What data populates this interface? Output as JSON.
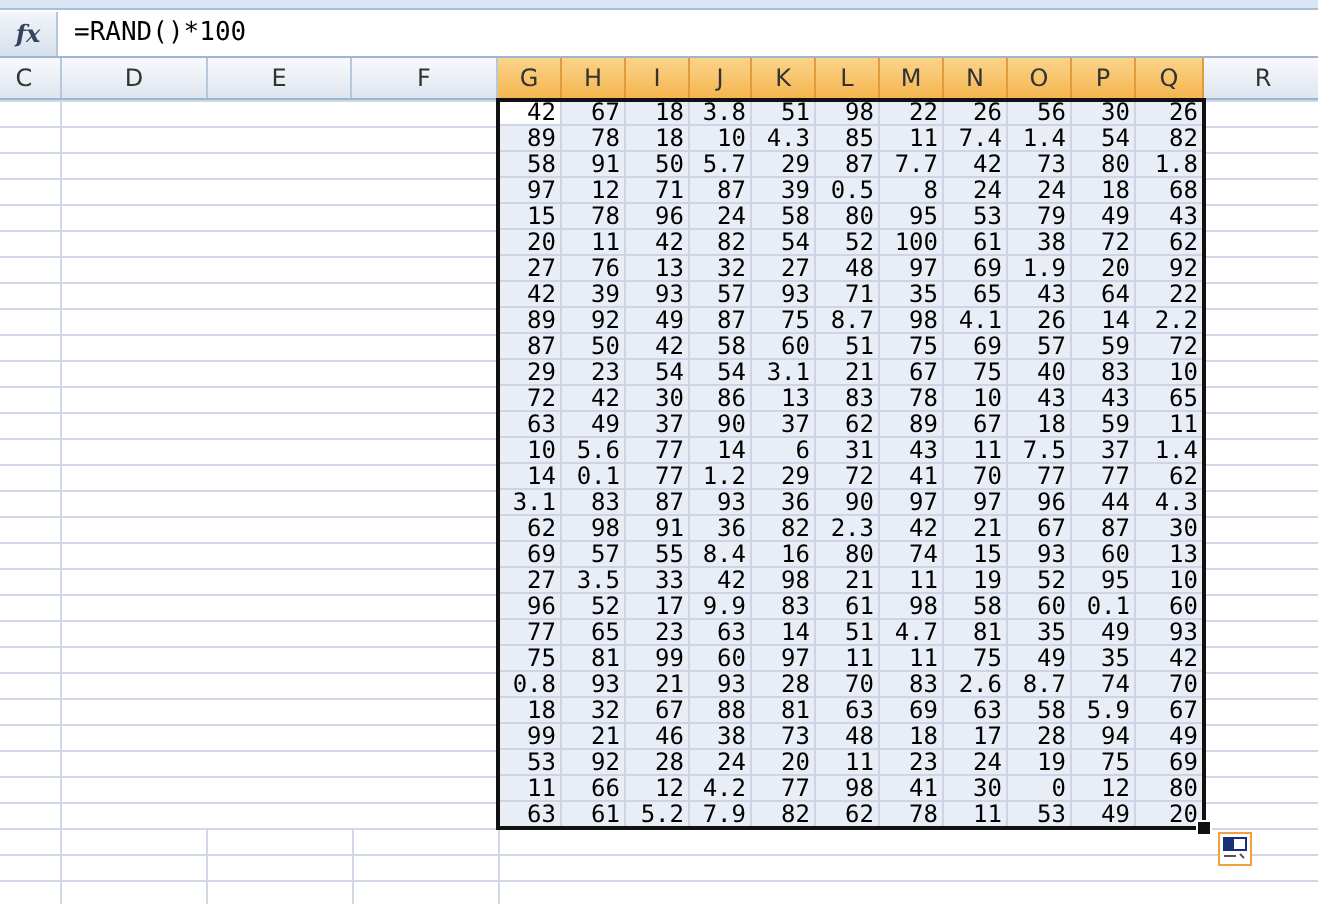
{
  "formula_bar": {
    "fx_label": "fx",
    "formula": "=RAND()*100"
  },
  "columns": [
    {
      "letter": "C",
      "selected": false
    },
    {
      "letter": "D",
      "selected": false
    },
    {
      "letter": "E",
      "selected": false
    },
    {
      "letter": "F",
      "selected": false
    },
    {
      "letter": "G",
      "selected": true
    },
    {
      "letter": "H",
      "selected": true
    },
    {
      "letter": "I",
      "selected": true
    },
    {
      "letter": "J",
      "selected": true
    },
    {
      "letter": "K",
      "selected": true
    },
    {
      "letter": "L",
      "selected": true
    },
    {
      "letter": "M",
      "selected": true
    },
    {
      "letter": "N",
      "selected": true
    },
    {
      "letter": "O",
      "selected": true
    },
    {
      "letter": "P",
      "selected": true
    },
    {
      "letter": "Q",
      "selected": true
    },
    {
      "letter": "R",
      "selected": false
    }
  ],
  "rows": [
    {
      "active_cell": true,
      "values": [
        "42",
        "67",
        "18",
        "3.8",
        "51",
        "98",
        "22",
        "26",
        "56",
        "30",
        "26"
      ]
    },
    {
      "active_cell": false,
      "values": [
        "89",
        "78",
        "18",
        "10",
        "4.3",
        "85",
        "11",
        "7.4",
        "1.4",
        "54",
        "82"
      ]
    },
    {
      "active_cell": false,
      "values": [
        "58",
        "91",
        "50",
        "5.7",
        "29",
        "87",
        "7.7",
        "42",
        "73",
        "80",
        "1.8"
      ]
    },
    {
      "active_cell": false,
      "values": [
        "97",
        "12",
        "71",
        "87",
        "39",
        "0.5",
        "8",
        "24",
        "24",
        "18",
        "68"
      ]
    },
    {
      "active_cell": false,
      "values": [
        "15",
        "78",
        "96",
        "24",
        "58",
        "80",
        "95",
        "53",
        "79",
        "49",
        "43"
      ]
    },
    {
      "active_cell": false,
      "values": [
        "20",
        "11",
        "42",
        "82",
        "54",
        "52",
        "100",
        "61",
        "38",
        "72",
        "62"
      ]
    },
    {
      "active_cell": false,
      "values": [
        "27",
        "76",
        "13",
        "32",
        "27",
        "48",
        "97",
        "69",
        "1.9",
        "20",
        "92"
      ]
    },
    {
      "active_cell": false,
      "values": [
        "42",
        "39",
        "93",
        "57",
        "93",
        "71",
        "35",
        "65",
        "43",
        "64",
        "22"
      ]
    },
    {
      "active_cell": false,
      "values": [
        "89",
        "92",
        "49",
        "87",
        "75",
        "8.7",
        "98",
        "4.1",
        "26",
        "14",
        "2.2"
      ]
    },
    {
      "active_cell": false,
      "values": [
        "87",
        "50",
        "42",
        "58",
        "60",
        "51",
        "75",
        "69",
        "57",
        "59",
        "72"
      ]
    },
    {
      "active_cell": false,
      "values": [
        "29",
        "23",
        "54",
        "54",
        "3.1",
        "21",
        "67",
        "75",
        "40",
        "83",
        "10"
      ]
    },
    {
      "active_cell": false,
      "values": [
        "72",
        "42",
        "30",
        "86",
        "13",
        "83",
        "78",
        "10",
        "43",
        "43",
        "65"
      ]
    },
    {
      "active_cell": false,
      "values": [
        "63",
        "49",
        "37",
        "90",
        "37",
        "62",
        "89",
        "67",
        "18",
        "59",
        "11"
      ]
    },
    {
      "active_cell": false,
      "values": [
        "10",
        "5.6",
        "77",
        "14",
        "6",
        "31",
        "43",
        "11",
        "7.5",
        "37",
        "1.4"
      ]
    },
    {
      "active_cell": false,
      "values": [
        "14",
        "0.1",
        "77",
        "1.2",
        "29",
        "72",
        "41",
        "70",
        "77",
        "77",
        "62"
      ]
    },
    {
      "active_cell": false,
      "values": [
        "3.1",
        "83",
        "87",
        "93",
        "36",
        "90",
        "97",
        "97",
        "96",
        "44",
        "4.3"
      ]
    },
    {
      "active_cell": false,
      "values": [
        "62",
        "98",
        "91",
        "36",
        "82",
        "2.3",
        "42",
        "21",
        "67",
        "87",
        "30"
      ]
    },
    {
      "active_cell": false,
      "values": [
        "69",
        "57",
        "55",
        "8.4",
        "16",
        "80",
        "74",
        "15",
        "93",
        "60",
        "13"
      ]
    },
    {
      "active_cell": false,
      "values": [
        "27",
        "3.5",
        "33",
        "42",
        "98",
        "21",
        "11",
        "19",
        "52",
        "95",
        "10"
      ]
    },
    {
      "active_cell": false,
      "values": [
        "96",
        "52",
        "17",
        "9.9",
        "83",
        "61",
        "98",
        "58",
        "60",
        "0.1",
        "60"
      ]
    },
    {
      "active_cell": false,
      "values": [
        "77",
        "65",
        "23",
        "63",
        "14",
        "51",
        "4.7",
        "81",
        "35",
        "49",
        "93"
      ]
    },
    {
      "active_cell": false,
      "values": [
        "75",
        "81",
        "99",
        "60",
        "97",
        "11",
        "11",
        "75",
        "49",
        "35",
        "42"
      ]
    },
    {
      "active_cell": false,
      "values": [
        "0.8",
        "93",
        "21",
        "93",
        "28",
        "70",
        "83",
        "2.6",
        "8.7",
        "74",
        "70"
      ]
    },
    {
      "active_cell": false,
      "values": [
        "18",
        "32",
        "67",
        "88",
        "81",
        "63",
        "69",
        "63",
        "58",
        "5.9",
        "67"
      ]
    },
    {
      "active_cell": false,
      "values": [
        "99",
        "21",
        "46",
        "38",
        "73",
        "48",
        "18",
        "17",
        "28",
        "94",
        "49"
      ]
    },
    {
      "active_cell": false,
      "values": [
        "53",
        "92",
        "28",
        "24",
        "20",
        "11",
        "23",
        "24",
        "19",
        "75",
        "69"
      ]
    },
    {
      "active_cell": false,
      "values": [
        "11",
        "66",
        "12",
        "4.2",
        "77",
        "98",
        "41",
        "30",
        "0",
        "12",
        "80"
      ]
    },
    {
      "active_cell": false,
      "values": [
        "63",
        "61",
        "5.2",
        "7.9",
        "82",
        "62",
        "78",
        "11",
        "53",
        "49",
        "20"
      ]
    }
  ]
}
